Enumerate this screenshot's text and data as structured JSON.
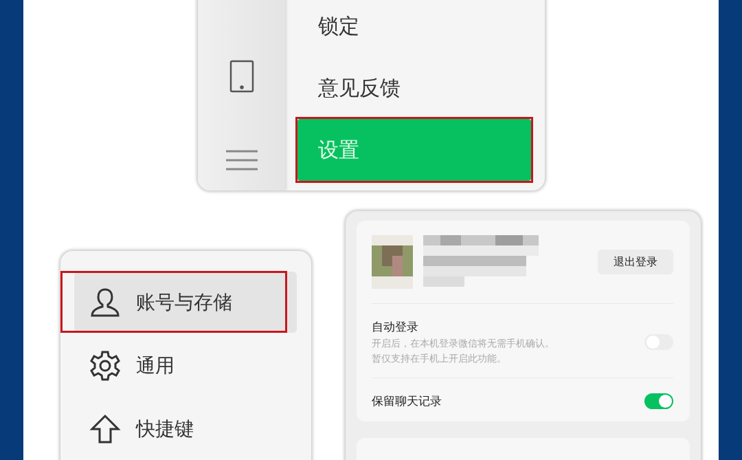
{
  "menu": {
    "items": [
      {
        "label": "锁定",
        "selected": false,
        "highlighted": false
      },
      {
        "label": "意见反馈",
        "selected": false,
        "highlighted": false
      },
      {
        "label": "设置",
        "selected": true,
        "highlighted": true
      }
    ]
  },
  "settings_nav": {
    "items": [
      {
        "label": "账号与存储",
        "kind": "person",
        "selected": true,
        "highlighted": true
      },
      {
        "label": "通用",
        "kind": "gear",
        "selected": false,
        "highlighted": false
      },
      {
        "label": "快捷键",
        "kind": "arrow-up",
        "selected": false,
        "highlighted": false
      }
    ]
  },
  "account": {
    "logout_button": "退出登录",
    "rows": [
      {
        "title": "自动登录",
        "description_lines": [
          "开启后，在本机登录微信将无需手机确认。",
          "暂仅支持在手机上开启此功能。"
        ],
        "on": false
      },
      {
        "title": "保留聊天记录",
        "on": true
      }
    ]
  }
}
